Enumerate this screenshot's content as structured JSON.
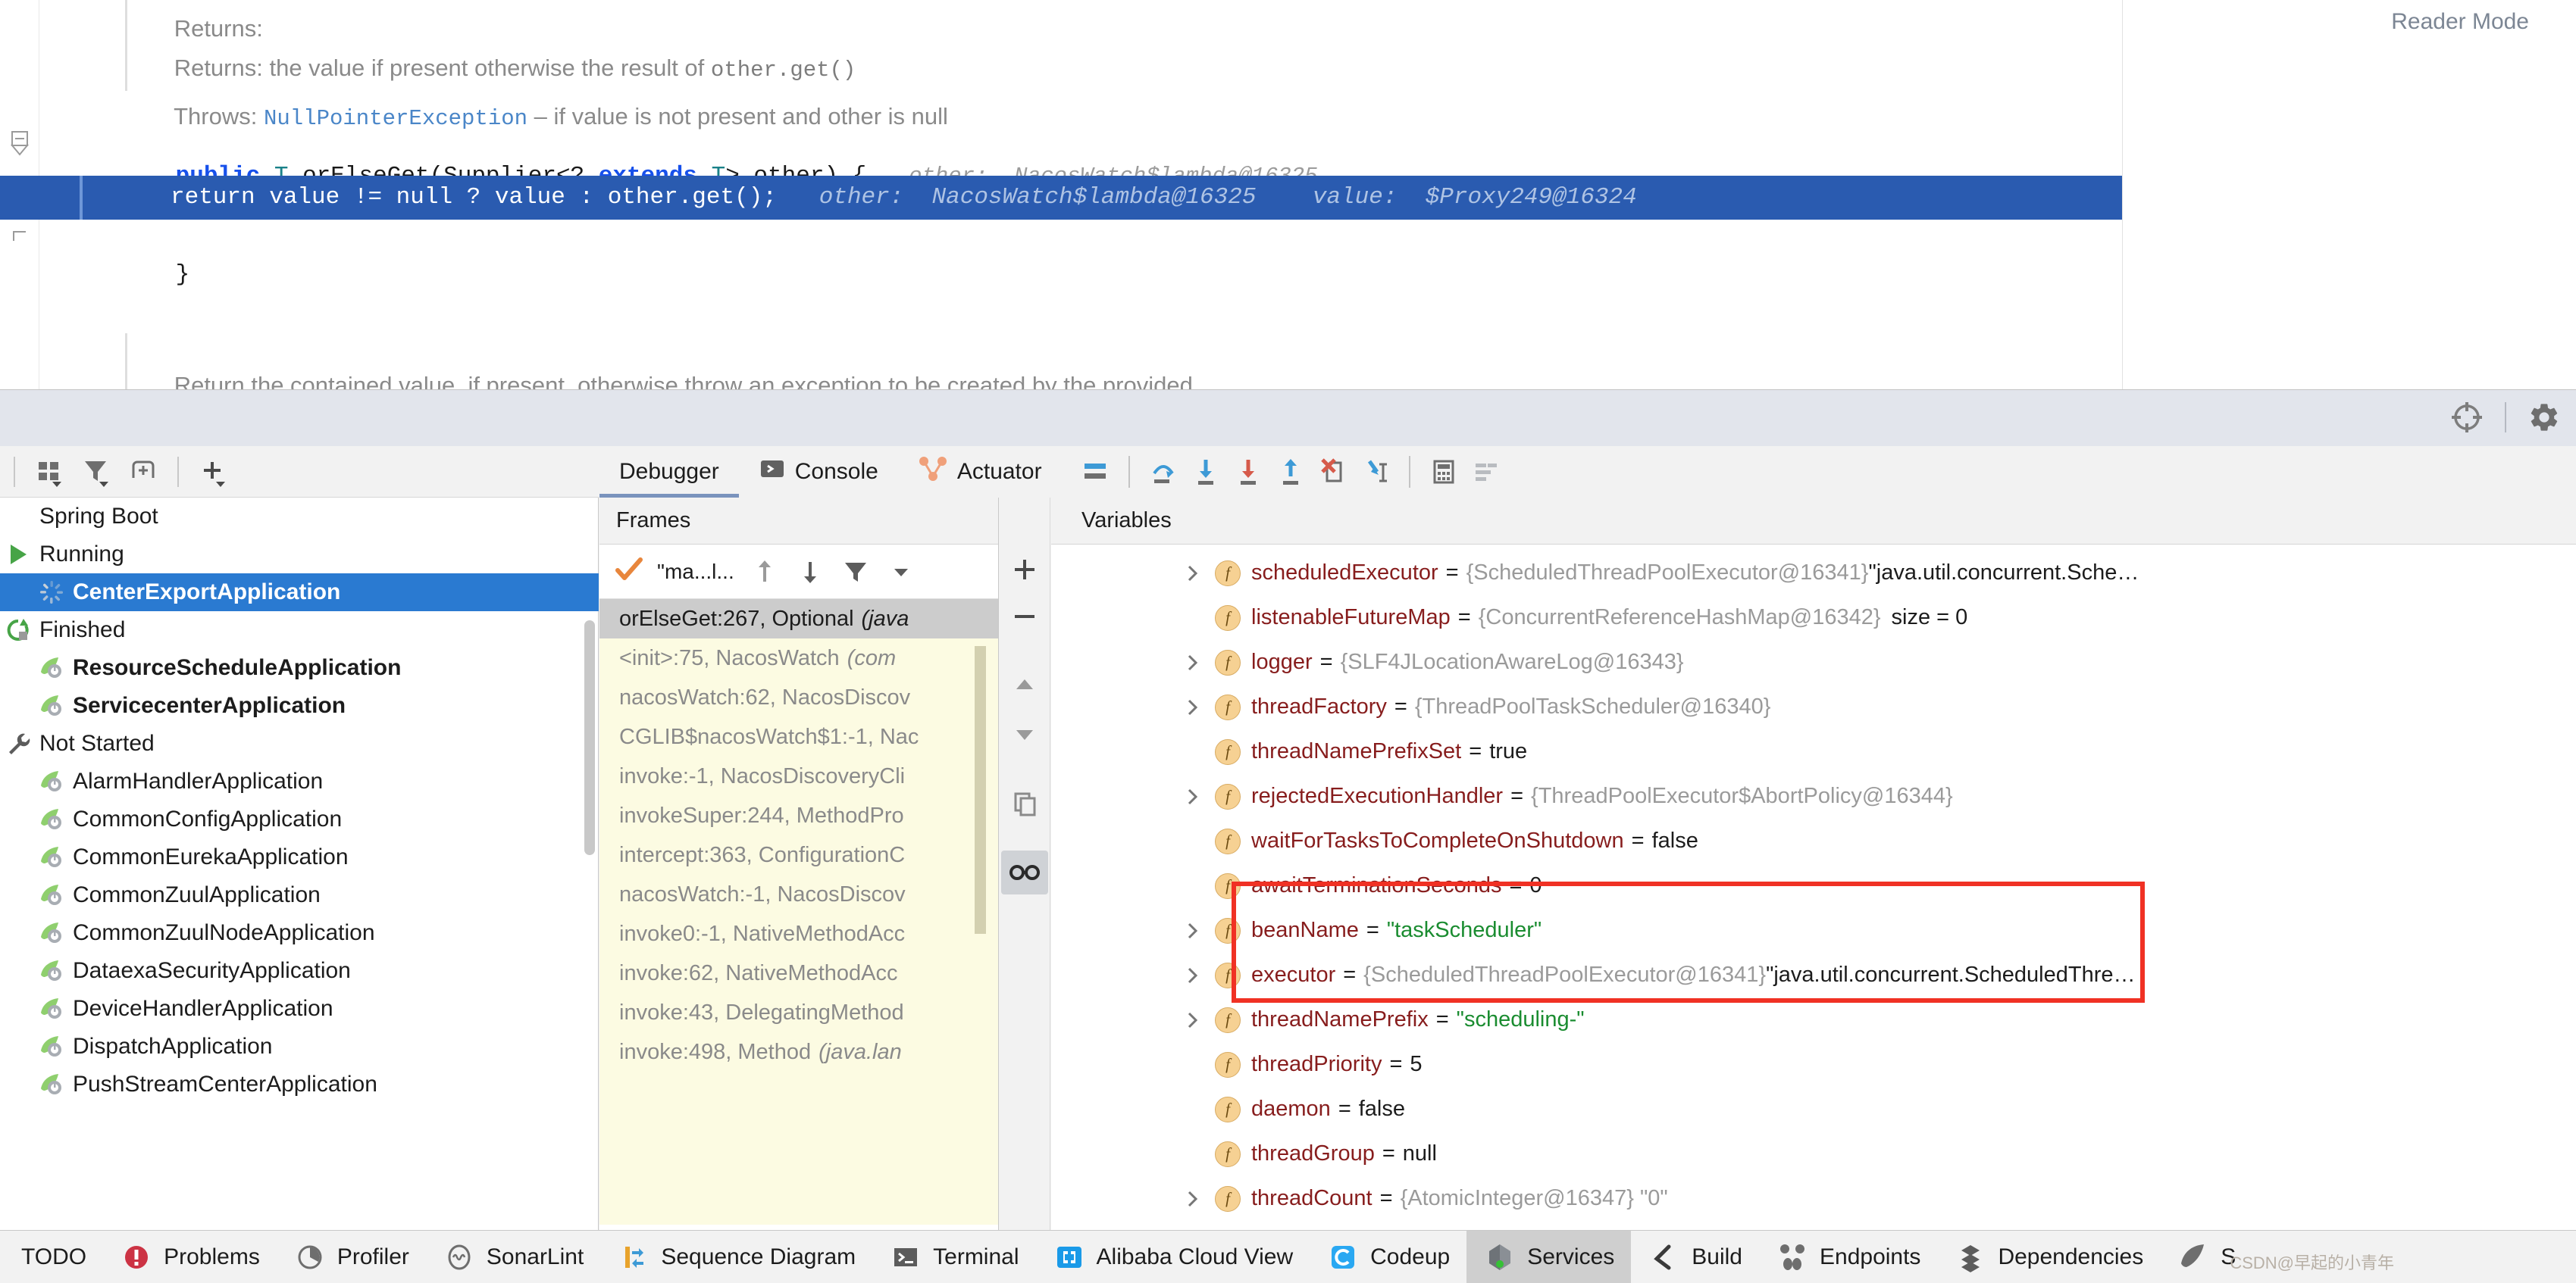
{
  "editor": {
    "reader_mode_label": "Reader Mode",
    "doc_lines": [
      {
        "prefix": "Returns: ",
        "text": "the value if present otherwise the result of ",
        "mono": "other.get()"
      },
      {
        "prefix": "Throws: ",
        "link": "NullPointerException",
        "text": " – if value is not present and other is null"
      }
    ],
    "signature": {
      "kw_public": "public",
      "type_T": "T",
      "method": " orElseGet",
      "paren_open": "(",
      "type_Supplier": "Supplier",
      "generic_open": "<? ",
      "kw_extends": "extends",
      "type_T2": " T",
      "generic_close": "> ",
      "param": "other",
      "paren_close": ") {",
      "inlay": "other:  NacosWatch$lambda@16325"
    },
    "exec_line": {
      "code": "return value != null ? value : other.get();",
      "inlay_other": "other:  NacosWatch$lambda@16325",
      "inlay_value": "value:  $Proxy249@16324"
    },
    "closing_brace": "}",
    "doc_bottom": "Return the contained value, if present, otherwise throw an exception to be created by the provided"
  },
  "services": {
    "toolbar": [
      {
        "name": "group-by-icon",
        "label": "Group By"
      },
      {
        "name": "filter-icon",
        "label": "Filter"
      },
      {
        "name": "add-tab-icon",
        "label": "Add Tab"
      },
      {
        "name": "add-icon",
        "label": "Add"
      }
    ],
    "items": [
      {
        "label": "Spring Boot",
        "level": "root",
        "icon": "none",
        "bold": false,
        "selected": false
      },
      {
        "label": "Running",
        "level": "group",
        "icon": "run-green-triangle-icon",
        "bold": false,
        "selected": false
      },
      {
        "label": "CenterExportApplication",
        "level": "child",
        "icon": "spinner-icon",
        "bold": true,
        "selected": true
      },
      {
        "label": "Finished",
        "level": "group",
        "icon": "rerun-finished-icon",
        "bold": false,
        "selected": false
      },
      {
        "label": "ResourceScheduleApplication",
        "level": "child",
        "icon": "spring-boot-icon",
        "bold": true,
        "selected": false
      },
      {
        "label": "ServicecenterApplication",
        "level": "child",
        "icon": "spring-boot-icon",
        "bold": true,
        "selected": false
      },
      {
        "label": "Not Started",
        "level": "group",
        "icon": "wrench-icon",
        "bold": false,
        "selected": false
      },
      {
        "label": "AlarmHandlerApplication",
        "level": "child",
        "icon": "spring-boot-icon",
        "bold": false,
        "selected": false
      },
      {
        "label": "CommonConfigApplication",
        "level": "child",
        "icon": "spring-boot-icon",
        "bold": false,
        "selected": false
      },
      {
        "label": "CommonEurekaApplication",
        "level": "child",
        "icon": "spring-boot-icon",
        "bold": false,
        "selected": false
      },
      {
        "label": "CommonZuulApplication",
        "level": "child",
        "icon": "spring-boot-icon",
        "bold": false,
        "selected": false
      },
      {
        "label": "CommonZuulNodeApplication",
        "level": "child",
        "icon": "spring-boot-icon",
        "bold": false,
        "selected": false
      },
      {
        "label": "DataexaSecurityApplication",
        "level": "child",
        "icon": "spring-boot-icon",
        "bold": false,
        "selected": false
      },
      {
        "label": "DeviceHandlerApplication",
        "level": "child",
        "icon": "spring-boot-icon",
        "bold": false,
        "selected": false
      },
      {
        "label": "DispatchApplication",
        "level": "child",
        "icon": "spring-boot-icon",
        "bold": false,
        "selected": false
      },
      {
        "label": "PushStreamCenterApplication",
        "level": "child",
        "icon": "spring-boot-icon",
        "bold": false,
        "selected": false
      }
    ]
  },
  "debugger": {
    "tabs": [
      {
        "label": "Debugger",
        "icon": "none",
        "active": true
      },
      {
        "label": "Console",
        "icon": "console-icon",
        "active": false
      },
      {
        "label": "Actuator",
        "icon": "actuator-icon",
        "active": false
      }
    ],
    "toolbar_icons": [
      "layout-settings-icon",
      "step-over-icon",
      "step-into-icon",
      "force-step-into-icon",
      "step-out-icon",
      "drop-frame-icon",
      "run-to-cursor-icon",
      "evaluate-expression-icon",
      "show-execution-point-icon"
    ],
    "frames": {
      "header": "Frames",
      "thread_selector": "\"ma...l...",
      "toolbar_icons": [
        "arrow-up-icon",
        "arrow-down-icon",
        "filter-icon",
        "chevron-down-icon"
      ],
      "rows": [
        {
          "text": "orElseGet:267, Optional",
          "pkg": "(java",
          "selected": true
        },
        {
          "text": "<init>:75, NacosWatch",
          "pkg": "(com",
          "selected": false
        },
        {
          "text": "nacosWatch:62, NacosDiscov",
          "pkg": "",
          "selected": false
        },
        {
          "text": "CGLIB$nacosWatch$1:-1, Nac",
          "pkg": "",
          "selected": false
        },
        {
          "text": "invoke:-1, NacosDiscoveryCli",
          "pkg": "",
          "selected": false
        },
        {
          "text": "invokeSuper:244, MethodPro",
          "pkg": "",
          "selected": false
        },
        {
          "text": "intercept:363, ConfigurationC",
          "pkg": "",
          "selected": false
        },
        {
          "text": "nacosWatch:-1, NacosDiscov",
          "pkg": "",
          "selected": false
        },
        {
          "text": "invoke0:-1, NativeMethodAcc",
          "pkg": "",
          "selected": false
        },
        {
          "text": "invoke:62, NativeMethodAcc",
          "pkg": "",
          "selected": false
        },
        {
          "text": "invoke:43, DelegatingMethod",
          "pkg": "",
          "selected": false
        },
        {
          "text": "invoke:498, Method",
          "pkg": "(java.lan",
          "selected": false
        }
      ]
    },
    "vars_toolbar_icons": [
      "add-watch-icon",
      "remove-watch-icon",
      "move-up-icon",
      "move-down-icon",
      "copy-icon",
      "inspect-icon"
    ],
    "variables": {
      "header": "Variables",
      "rows": [
        {
          "arrow": true,
          "name": "scheduledExecutor",
          "value": "{ScheduledThreadPoolExecutor@16341}",
          "kind": "obj",
          "tail": "\"java.util.concurrent.Sche…",
          "highlight": false
        },
        {
          "arrow": false,
          "name": "listenableFutureMap",
          "value": "{ConcurrentReferenceHashMap@16342}",
          "kind": "obj",
          "extra": "size = 0",
          "highlight": false
        },
        {
          "arrow": true,
          "name": "logger",
          "value": "{SLF4JLocationAwareLog@16343}",
          "kind": "obj",
          "highlight": false
        },
        {
          "arrow": true,
          "name": "threadFactory",
          "value": "{ThreadPoolTaskScheduler@16340}",
          "kind": "obj",
          "highlight": false
        },
        {
          "arrow": false,
          "name": "threadNamePrefixSet",
          "value": "true",
          "kind": "bool",
          "highlight": false
        },
        {
          "arrow": true,
          "name": "rejectedExecutionHandler",
          "value": "{ThreadPoolExecutor$AbortPolicy@16344}",
          "kind": "obj",
          "highlight": false
        },
        {
          "arrow": false,
          "name": "waitForTasksToCompleteOnShutdown",
          "value": "false",
          "kind": "bool",
          "highlight": false
        },
        {
          "arrow": false,
          "name": "awaitTerminationSeconds",
          "value": "0",
          "kind": "num",
          "highlight": true
        },
        {
          "arrow": true,
          "name": "beanName",
          "value": "\"taskScheduler\"",
          "kind": "str",
          "highlight": true
        },
        {
          "arrow": true,
          "name": "executor",
          "value": "{ScheduledThreadPoolExecutor@16341}",
          "kind": "obj",
          "tail": "\"java.util.concurrent.ScheduledThre…",
          "highlight": true
        },
        {
          "arrow": true,
          "name": "threadNamePrefix",
          "value": "\"scheduling-\"",
          "kind": "str",
          "highlight": true
        },
        {
          "arrow": false,
          "name": "threadPriority",
          "value": "5",
          "kind": "num",
          "highlight": true
        },
        {
          "arrow": false,
          "name": "daemon",
          "value": "false",
          "kind": "bool",
          "highlight": true
        },
        {
          "arrow": false,
          "name": "threadGroup",
          "value": "null",
          "kind": "num",
          "highlight": false
        },
        {
          "arrow": true,
          "name": "threadCount",
          "value": "{AtomicInteger@16347} \"0\"",
          "kind": "obj",
          "highlight": false
        }
      ],
      "highlight_color": "#f03124"
    }
  },
  "statusbar": {
    "items": [
      {
        "label": "TODO",
        "icon": "none",
        "active": false
      },
      {
        "label": "Problems",
        "icon": "problems-icon",
        "active": false
      },
      {
        "label": "Profiler",
        "icon": "profiler-icon",
        "active": false
      },
      {
        "label": "SonarLint",
        "icon": "sonarlint-icon",
        "active": false
      },
      {
        "label": "Sequence Diagram",
        "icon": "sequence-diagram-icon",
        "active": false
      },
      {
        "label": "Terminal",
        "icon": "terminal-icon",
        "active": false
      },
      {
        "label": "Alibaba Cloud View",
        "icon": "alibaba-cloud-icon",
        "active": false
      },
      {
        "label": "Codeup",
        "icon": "codeup-icon",
        "active": false
      },
      {
        "label": "Services",
        "icon": "services-icon",
        "active": true
      },
      {
        "label": "Build",
        "icon": "build-icon",
        "active": false
      },
      {
        "label": "Endpoints",
        "icon": "endpoints-icon",
        "active": false
      },
      {
        "label": "Dependencies",
        "icon": "dependencies-icon",
        "active": false
      },
      {
        "label": "S",
        "icon": "spring-icon",
        "active": false
      }
    ],
    "watermark": "CSDN@早起的小青年"
  }
}
